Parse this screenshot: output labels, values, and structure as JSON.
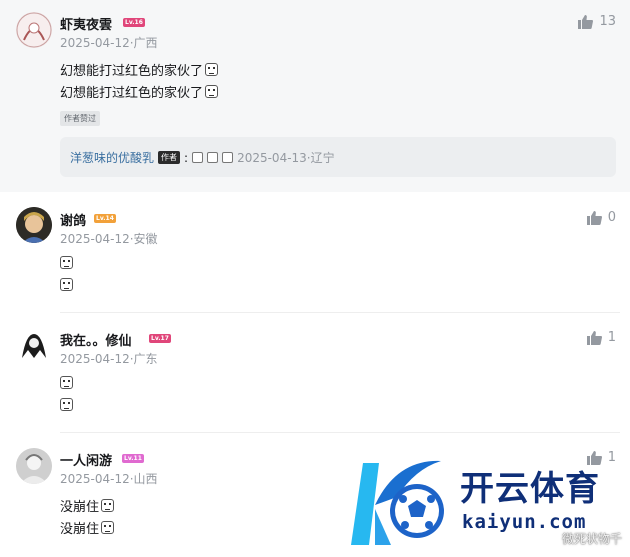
{
  "colors": {
    "level_pink": "#e0467a",
    "level_orange": "#f2a13a",
    "logo_blue": "#0f2f78",
    "logo_cyan": "#27b8f0"
  },
  "comments": [
    {
      "username": "虾夷夜雲",
      "level": "Lv.16",
      "level_color": "#e0467a",
      "meta": "2025-04-12·广西",
      "likes": "13",
      "lines": [
        "幻想能打过红色的家伙了",
        "幻想能打过红色的家伙了"
      ],
      "tag": "作者赞过",
      "reply": {
        "username": "洋葱味的优酸乳",
        "author_tag": "作者",
        "meta": "2025-04-13·辽宁"
      }
    },
    {
      "username": "谢鸽",
      "level": "Lv.14",
      "level_color": "#f2a13a",
      "meta": "2025-04-12·安徽",
      "likes": "0",
      "lines": [
        "",
        ""
      ]
    },
    {
      "username": "我在。。修仙",
      "level": "Lv.17",
      "level_color": "#e0467a",
      "meta": "2025-04-12·广东",
      "likes": "1",
      "lines": [
        "",
        ""
      ]
    },
    {
      "username": "一人闲游",
      "level": "Lv.11",
      "level_color": "#e06ad0",
      "meta": "2025-04-12·山西",
      "likes": "1",
      "lines": [
        "没崩住",
        "没崩住"
      ]
    }
  ],
  "logo": {
    "cn": "开云体育",
    "en": "kaiyun.com"
  },
  "watermark": "微死状物千"
}
